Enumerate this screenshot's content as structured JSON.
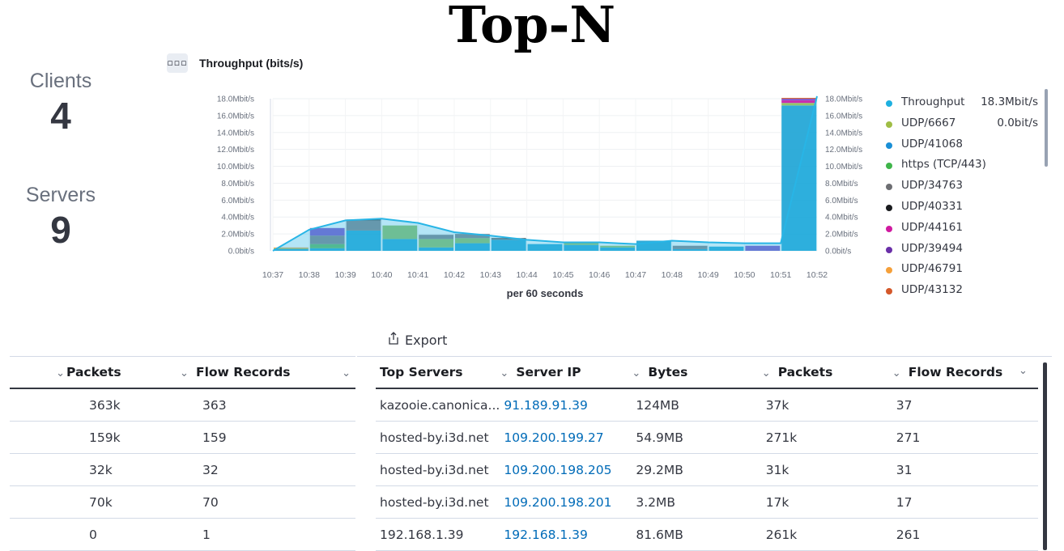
{
  "page": {
    "title": "Top-N"
  },
  "stats": {
    "clients_label": "Clients",
    "clients_value": "4",
    "servers_label": "Servers",
    "servers_value": "9"
  },
  "chart_panel": {
    "menu_icon": "dots-icon",
    "title": "Throughput (bits/s)"
  },
  "chart_data": {
    "type": "bar",
    "title": "Throughput (bits/s)",
    "xlabel": "per 60 seconds",
    "ylabel": "",
    "ylim": [
      0,
      18.0
    ],
    "y_unit": "Mbit/s",
    "y_ticks": [
      "18.0Mbit/s",
      "16.0Mbit/s",
      "14.0Mbit/s",
      "12.0Mbit/s",
      "10.0Mbit/s",
      "8.0Mbit/s",
      "6.0Mbit/s",
      "4.0Mbit/s",
      "2.0Mbit/s",
      "0.0bit/s"
    ],
    "categories": [
      "10:37",
      "10:38",
      "10:39",
      "10:40",
      "10:41",
      "10:42",
      "10:43",
      "10:44",
      "10:45",
      "10:46",
      "10:47",
      "10:48",
      "10:49",
      "10:50",
      "10:51",
      "10:52"
    ],
    "grid": true,
    "legend_position": "right",
    "series": [
      {
        "name": "UDP/41068",
        "color": "#1ea5d6",
        "values": [
          0.2,
          0.3,
          2.4,
          1.4,
          0.4,
          0.9,
          1.3,
          0.8,
          0.7,
          0.4,
          1.2,
          0.2,
          0.5,
          0.0,
          17.2,
          0
        ]
      },
      {
        "name": "https (TCP/443)",
        "color": "#5ab65a",
        "values": [
          0.0,
          0.5,
          0.0,
          0.0,
          0.0,
          0.0,
          0.0,
          0.0,
          0.0,
          0.0,
          0.0,
          0.0,
          0.0,
          0.0,
          0.0,
          0
        ]
      },
      {
        "name": "UDP/6667",
        "color": "#8bbf5e",
        "values": [
          0.1,
          0.0,
          0.0,
          1.6,
          1.0,
          0.6,
          0.0,
          0.0,
          0.3,
          0.2,
          0.0,
          0.0,
          0.0,
          0.0,
          0.3,
          0
        ]
      },
      {
        "name": "UDP/34763",
        "color": "#7d7f85",
        "values": [
          0.0,
          1.0,
          1.2,
          0.0,
          0.5,
          0.5,
          0.1,
          0.0,
          0.0,
          0.0,
          0.0,
          0.4,
          0.0,
          0.0,
          0.0,
          0
        ]
      },
      {
        "name": "UDP/40331",
        "color": "#2b2c30",
        "values": [
          0.0,
          0.0,
          0.1,
          0.0,
          0.0,
          0.0,
          0.1,
          0.0,
          0.0,
          0.0,
          0.0,
          0.0,
          0.0,
          0.0,
          0.0,
          0
        ]
      },
      {
        "name": "UDP/44161",
        "color": "#c21aa8",
        "values": [
          0.0,
          0.0,
          0.0,
          0.0,
          0.0,
          0.0,
          0.0,
          0.0,
          0.0,
          0.0,
          0.0,
          0.0,
          0.0,
          0.0,
          0.3,
          0
        ]
      },
      {
        "name": "UDP/39494",
        "color": "#7a4cc8",
        "values": [
          0.0,
          0.9,
          0.0,
          0.0,
          0.0,
          0.0,
          0.0,
          0.0,
          0.0,
          0.0,
          0.0,
          0.0,
          0.0,
          0.6,
          0.2,
          0
        ]
      },
      {
        "name": "UDP/46791",
        "color": "#f0a342",
        "values": [
          0.1,
          0.0,
          0.0,
          0.0,
          0.0,
          0.0,
          0.0,
          0.0,
          0.0,
          0.0,
          0.0,
          0.0,
          0.0,
          0.0,
          0.0,
          0
        ]
      },
      {
        "name": "UDP/43132",
        "color": "#d4602a",
        "values": [
          0.0,
          0.0,
          0.0,
          0.0,
          0.0,
          0.0,
          0.0,
          0.0,
          0.0,
          0.0,
          0.0,
          0.0,
          0.0,
          0.0,
          0.1,
          0
        ]
      }
    ],
    "throughput_line": {
      "name": "Throughput",
      "color": "#28b5e6",
      "values": [
        0.0,
        2.5,
        3.6,
        3.8,
        3.3,
        2.2,
        1.8,
        1.3,
        1.0,
        1.0,
        0.8,
        1.2,
        1.0,
        0.9,
        0.9,
        18.3
      ]
    }
  },
  "legend": [
    {
      "label": "Throughput",
      "value": "18.3Mbit/s",
      "color": "#1eb0e0"
    },
    {
      "label": "UDP/6667",
      "value": "0.0bit/s",
      "color": "#9fbd45"
    },
    {
      "label": "UDP/41068",
      "value": "",
      "color": "#1a8fd6"
    },
    {
      "label": "https (TCP/443)",
      "value": "",
      "color": "#3fb54a"
    },
    {
      "label": "UDP/34763",
      "value": "",
      "color": "#6d6e72"
    },
    {
      "label": "UDP/40331",
      "value": "",
      "color": "#1a1b1e"
    },
    {
      "label": "UDP/44161",
      "value": "",
      "color": "#d01aa0"
    },
    {
      "label": "UDP/39494",
      "value": "",
      "color": "#6a2fa8"
    },
    {
      "label": "UDP/46791",
      "value": "",
      "color": "#f5a03a"
    },
    {
      "label": "UDP/43132",
      "value": "",
      "color": "#d4582a"
    }
  ],
  "export": {
    "label": "Export",
    "icon": "share-export-icon"
  },
  "left_table": {
    "columns": [
      "Packets",
      "Flow Records"
    ],
    "rows": [
      [
        "363k",
        "363"
      ],
      [
        "159k",
        "159"
      ],
      [
        "32k",
        "32"
      ],
      [
        "70k",
        "70"
      ],
      [
        "0",
        "1"
      ]
    ]
  },
  "right_table": {
    "columns": [
      "Top Servers",
      "Server IP",
      "Bytes",
      "Packets",
      "Flow Records"
    ],
    "rows": [
      [
        "kazooie.canonica...",
        "91.189.91.39",
        "124MB",
        "37k",
        "37"
      ],
      [
        "hosted-by.i3d.net",
        "109.200.199.27",
        "54.9MB",
        "271k",
        "271"
      ],
      [
        "hosted-by.i3d.net",
        "109.200.198.205",
        "29.2MB",
        "31k",
        "31"
      ],
      [
        "hosted-by.i3d.net",
        "109.200.198.201",
        "3.2MB",
        "17k",
        "17"
      ],
      [
        "192.168.1.39",
        "192.168.1.39",
        "81.6MB",
        "261k",
        "261"
      ]
    ]
  }
}
